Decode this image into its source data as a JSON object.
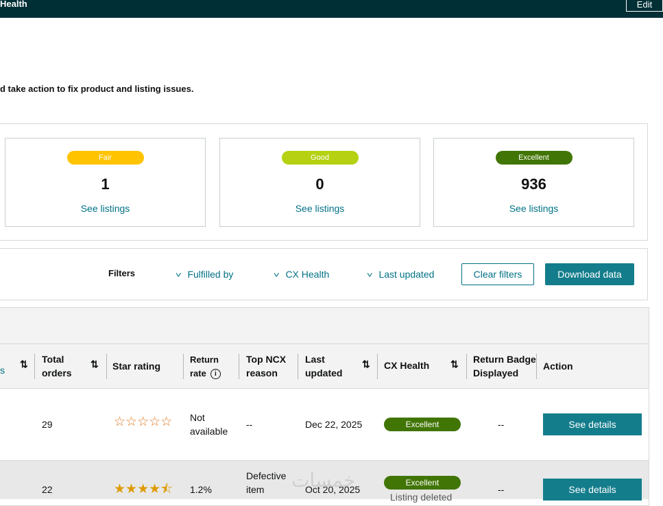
{
  "topbar": {
    "title": "Health",
    "edit_label": "Edit"
  },
  "subtitle": "d take action to fix product and listing issues.",
  "summary": {
    "cards": [
      {
        "badge": "Fair",
        "color": "#ffc300",
        "count": "1",
        "link": "See listings"
      },
      {
        "badge": "Good",
        "color": "#b5d111",
        "count": "0",
        "link": "See listings"
      },
      {
        "badge": "Excellent",
        "color": "#417505",
        "count": "936",
        "link": "See listings"
      }
    ]
  },
  "filters": {
    "label": "Filters",
    "dropdowns": [
      "Fulfilled by",
      "CX Health",
      "Last updated"
    ],
    "clear_label": "Clear filters",
    "download_label": "Download data"
  },
  "table": {
    "headers": {
      "partial": "s",
      "total_orders": [
        "Total",
        "orders"
      ],
      "star_rating": "Star rating",
      "return_rate": [
        "Return",
        "rate"
      ],
      "top_ncx": [
        "Top NCX",
        "reason"
      ],
      "last_updated": [
        "Last",
        "updated"
      ],
      "cx_health": "CX Health",
      "return_badge": [
        "Return Badge",
        "Displayed"
      ],
      "action": "Action"
    },
    "rows": [
      {
        "total_orders": "29",
        "stars": "☆☆☆☆☆",
        "star_value": 0,
        "return_rate": [
          "Not",
          "available"
        ],
        "top_ncx": [
          "--"
        ],
        "last_updated": "Dec 22, 2025",
        "cx_health": "Excellent",
        "cx_note": "",
        "return_badge": "--",
        "action": "See details"
      },
      {
        "total_orders": "22",
        "stars": "★★★★⯪",
        "star_value": 4.5,
        "return_rate": [
          "1.2%"
        ],
        "top_ncx": [
          "Defective",
          "item"
        ],
        "last_updated": "Oct 20, 2025",
        "cx_health": "Excellent",
        "cx_note": "Listing deleted",
        "return_badge": "--",
        "action": "See details"
      }
    ]
  },
  "watermark": "خمسات"
}
